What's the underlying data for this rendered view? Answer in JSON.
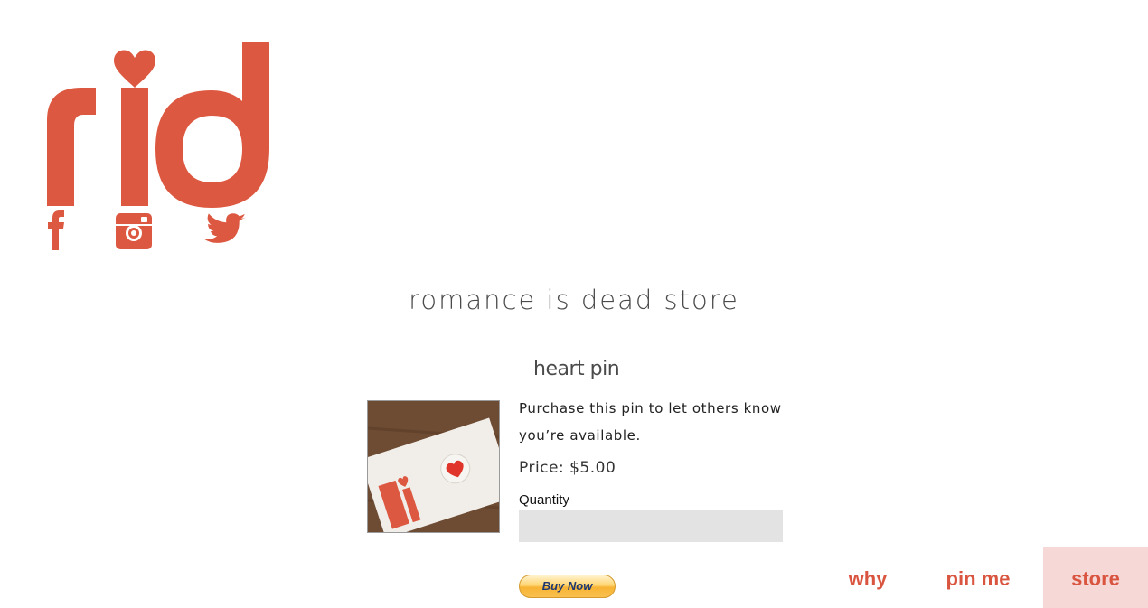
{
  "brand": {
    "logo_text": "rid",
    "accent_color": "#dd5840"
  },
  "social": [
    {
      "name": "facebook",
      "icon": "facebook-icon"
    },
    {
      "name": "instagram",
      "icon": "instagram-icon"
    },
    {
      "name": "twitter",
      "icon": "twitter-icon"
    }
  ],
  "store": {
    "title": "romance is dead store"
  },
  "product": {
    "name": "heart pin",
    "description": "Purchase this pin to let others know you’re available.",
    "price": "Price: $5.00",
    "quantity_label": "Quantity",
    "quantity_value": "",
    "buy_button": "Buy Now"
  },
  "nav": {
    "items": [
      {
        "label": "why"
      },
      {
        "label": "pin me"
      },
      {
        "label": "store",
        "active": true
      }
    ],
    "active_bg": "#f6d8d6"
  }
}
